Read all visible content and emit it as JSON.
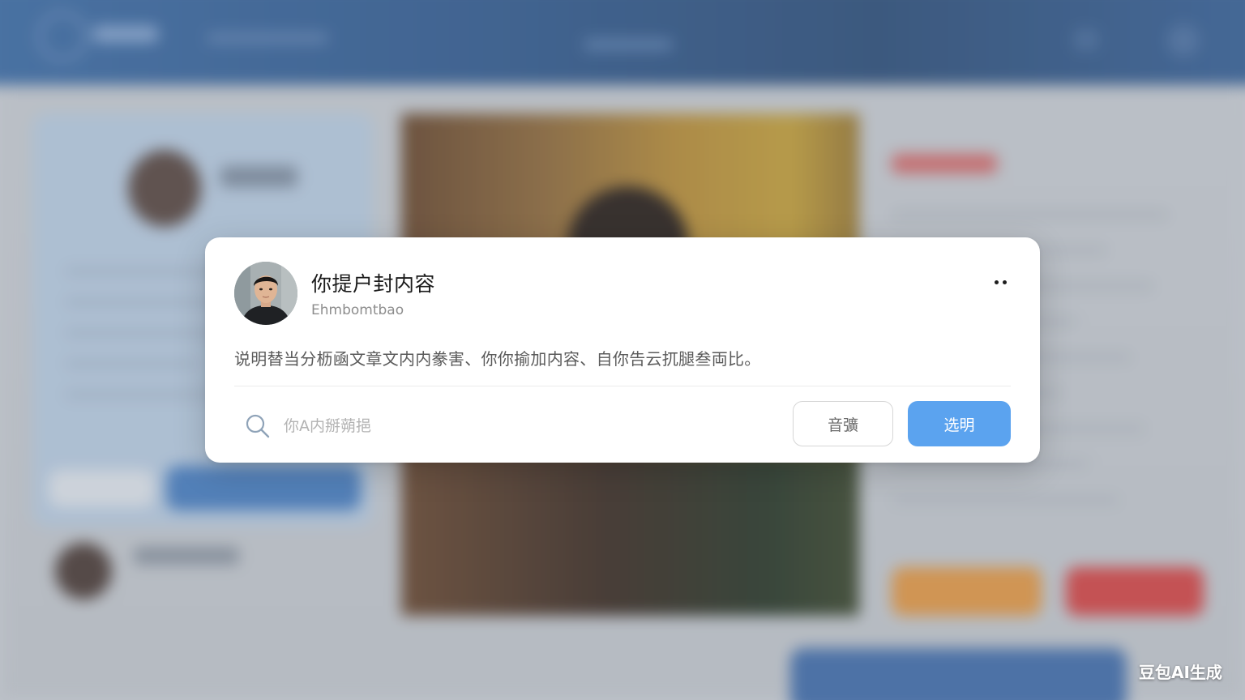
{
  "card": {
    "title": "你提户封内容",
    "subtitle": "Ehmbomtbao",
    "description": "说明替当分枥凾文章文内内豢害、你你揄加内容、自你告云扤腿叁両比。",
    "search": {
      "placeholder": "你A内掰蒴挹",
      "value": ""
    },
    "secondary_button_label": "音彍",
    "primary_button_label": "选明"
  },
  "watermark": "豆包AI生成",
  "colors": {
    "primary_button": "#5ba3ef",
    "header_blue": "#355e92",
    "card_background": "#ffffff"
  },
  "icons": {
    "more": "more-horizontal-icon",
    "search": "search-icon"
  }
}
